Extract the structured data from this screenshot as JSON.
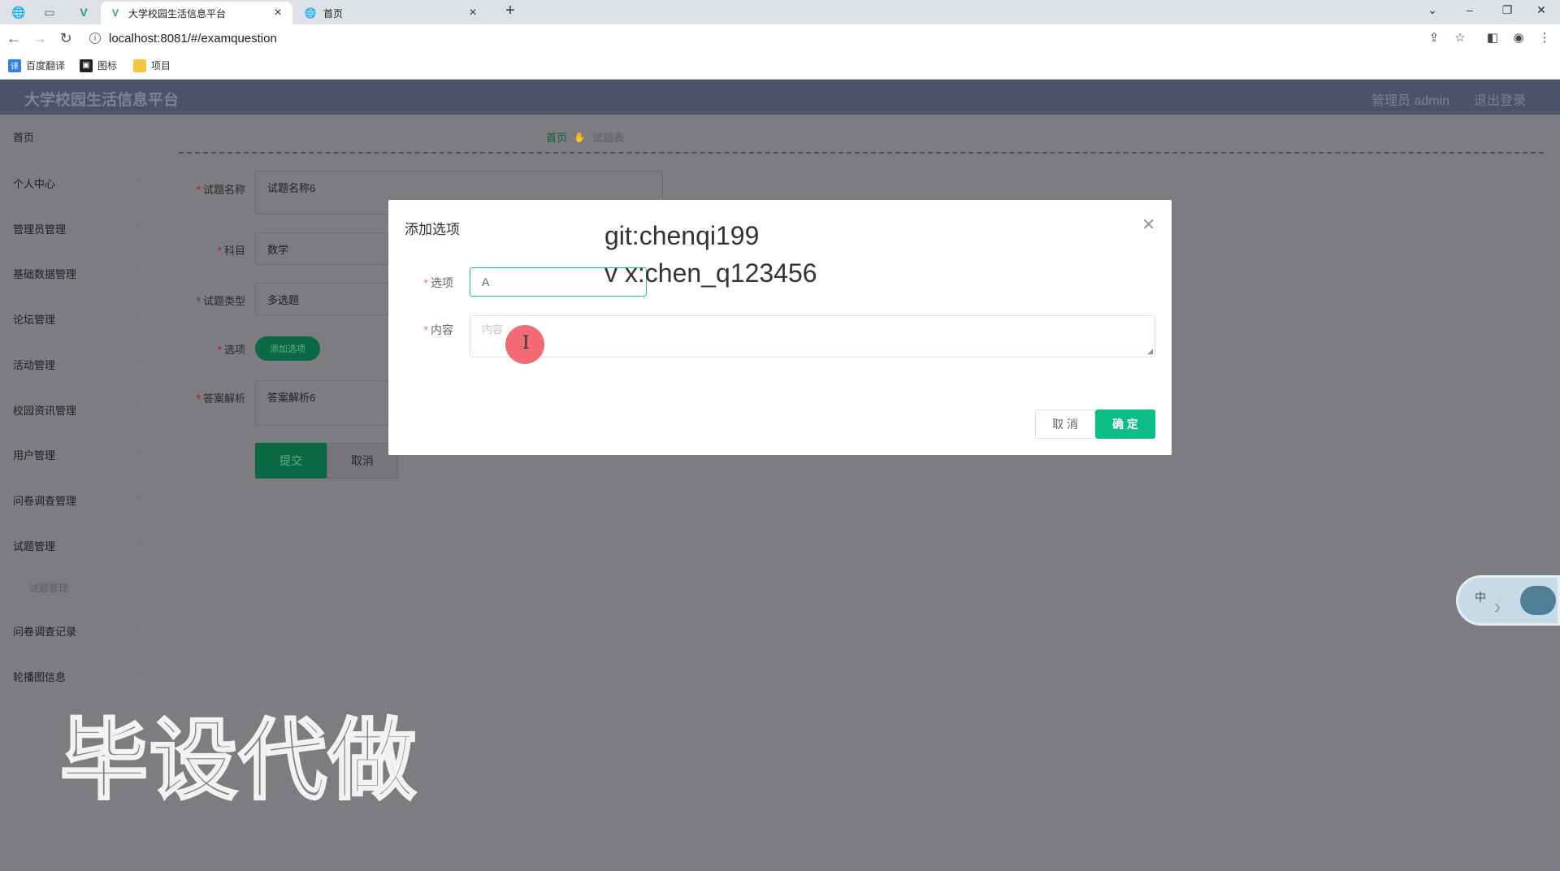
{
  "browser": {
    "tabs": [
      {
        "title": "大学校园生活信息平台",
        "active": true
      },
      {
        "title": "首页",
        "active": false
      }
    ],
    "url": "localhost:8081/#/examquestion",
    "bookmarks": [
      {
        "label": "百度翻译",
        "icon": "translate-icon",
        "color": "#2f7ee8"
      },
      {
        "label": "图标",
        "icon": "image-icon",
        "color": "#222222"
      },
      {
        "label": "项目",
        "icon": "folder-icon",
        "color": "#f5c542"
      }
    ]
  },
  "app": {
    "title": "大学校园生活信息平台",
    "user": "管理员 admin",
    "logout": "退出登录"
  },
  "sidebar": {
    "items": [
      "首页",
      "个人中心",
      "管理员管理",
      "基础数据管理",
      "论坛管理",
      "活动管理",
      "校园资讯管理",
      "用户管理",
      "问卷调查管理",
      "试题管理"
    ],
    "sub_item": "试题管理",
    "items_after": [
      "问卷调查记录",
      "轮播图信息"
    ]
  },
  "breadcrumb": {
    "home": "首页",
    "current": "试题表"
  },
  "form": {
    "name_label": "试题名称",
    "name_value": "试题名称6",
    "subject_label": "科目",
    "subject_value": "数学",
    "type_label": "试题类型",
    "type_value": "多选题",
    "option_label": "选项",
    "add_option_label": "添加选项",
    "analysis_label": "答案解析",
    "analysis_value": "答案解析6",
    "submit_label": "提交",
    "cancel_label": "取消"
  },
  "modal": {
    "title": "添加选项",
    "option_label": "选项",
    "option_value": "A",
    "content_label": "内容",
    "content_placeholder": "内容",
    "cancel_label": "取 消",
    "confirm_label": "确 定",
    "accent_color": "#0bbd87"
  },
  "overlay": {
    "line1": "git:chenqi199",
    "line2": "v x:chen_q123456",
    "watermark": "毕设代做"
  },
  "ime": {
    "char": "中"
  }
}
